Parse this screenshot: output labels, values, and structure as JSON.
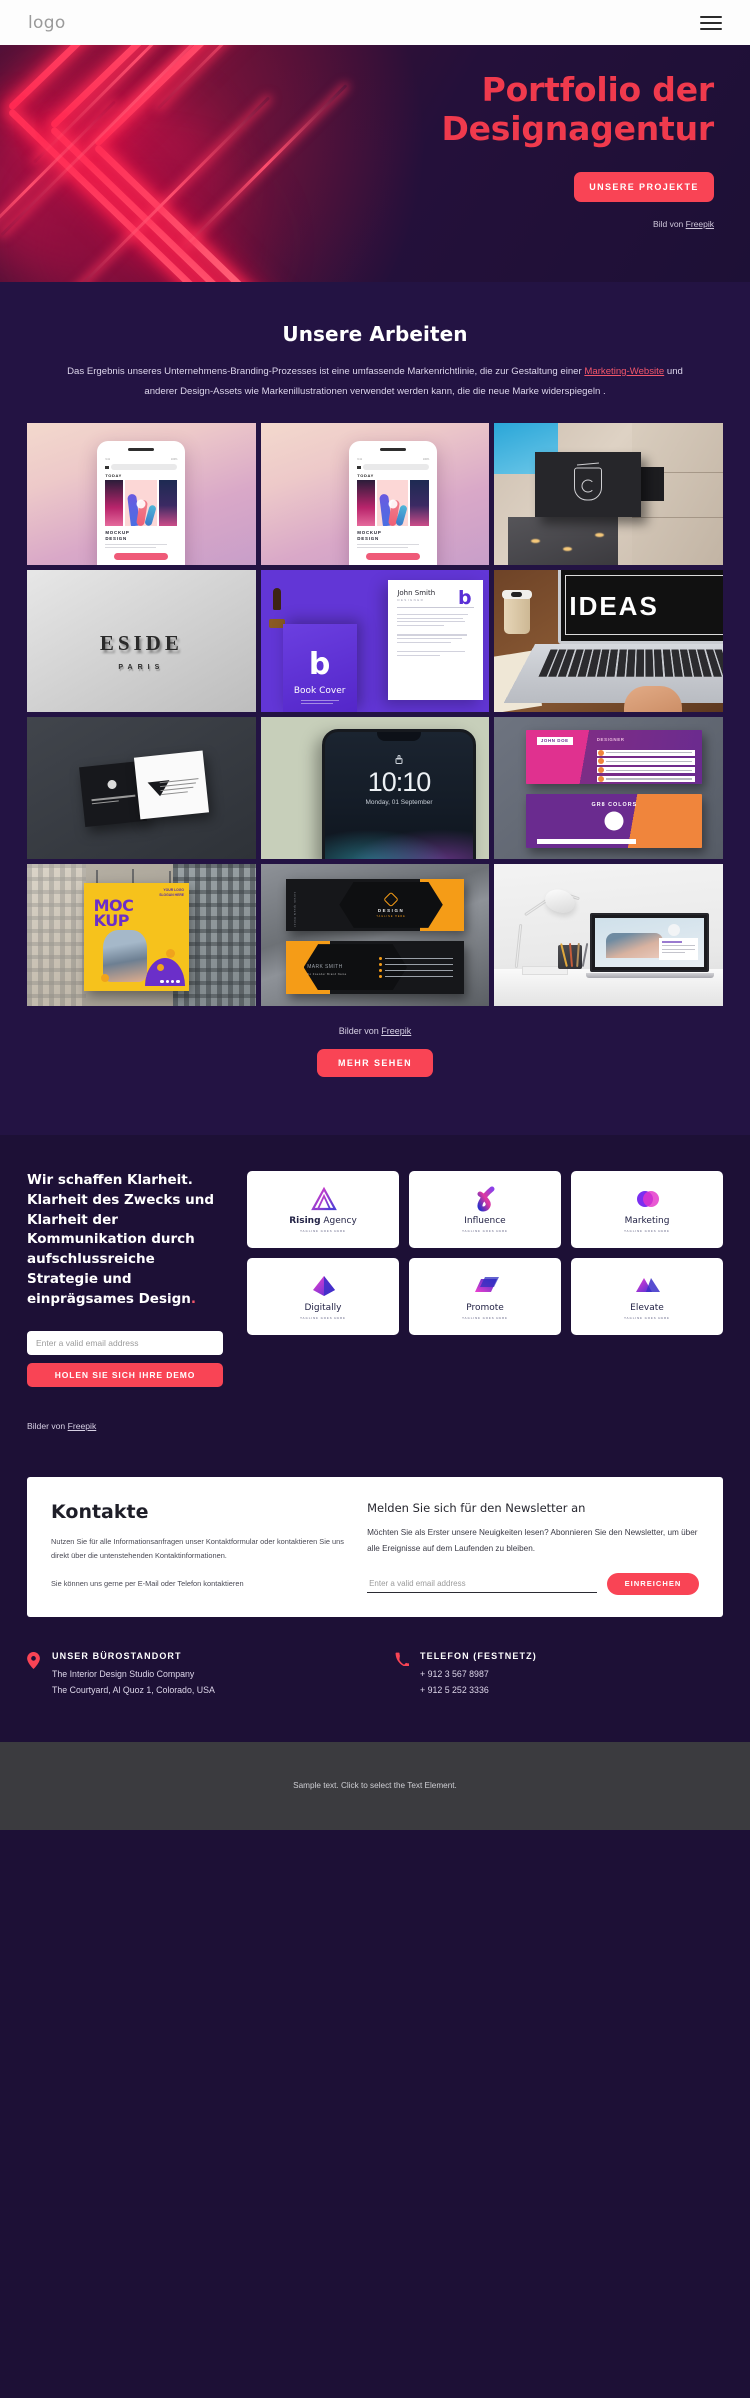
{
  "nav": {
    "logo": "logo",
    "menu_icon": "hamburger-icon"
  },
  "hero": {
    "title_line1": "Portfolio der",
    "title_line2": "Designagentur",
    "cta": "UNSERE PROJEKTE",
    "credit_prefix": "Bild von ",
    "credit_link": "Freepik"
  },
  "works": {
    "title": "Unsere Arbeiten",
    "desc_part1": "Das Ergebnis unseres Unternehmens-Branding-Prozesses ist eine umfassende Markenrichtlinie, die zur Gestaltung einer ",
    "desc_link": "Marketing-Website",
    "desc_part2": " und anderer Design-Assets wie Markenillustrationen verwendet werden kann, die die neue Marke widerspiegeln .",
    "gallery_credit_prefix": "Bilder von ",
    "gallery_credit_link": "Freepik",
    "more_button": "MEHR SEHEN",
    "tiles": [
      {
        "name": "phone-mockup-1",
        "status_left": "9:41",
        "status_right": "100%",
        "today": "TODAY",
        "caption_l1": "MOCKUP",
        "caption_l2": "DESIGN"
      },
      {
        "name": "phone-mockup-2",
        "status_left": "9:41",
        "status_right": "100%",
        "today": "TODAY",
        "caption_l1": "MOCKUP",
        "caption_l2": "DESIGN"
      },
      {
        "name": "storefront-sign-mockup"
      },
      {
        "name": "eside-paris-wall-logo",
        "word": "ESIDE",
        "sub": "PARIS"
      },
      {
        "name": "purple-branding-stationery",
        "person": "John Smith",
        "role": "DESIGNER",
        "book": "Book Cover",
        "letter": "b"
      },
      {
        "name": "laptop-ideas-desk",
        "word": "IDEAS"
      },
      {
        "name": "dark-business-cards"
      },
      {
        "name": "phone-lock-screen",
        "time": "10:10",
        "date": "Monday, 01 September"
      },
      {
        "name": "pink-purple-business-cards",
        "front_name": "JOHN DOE",
        "front_role": "DESIGNER",
        "back_title": "GR8 COLORS"
      },
      {
        "name": "billboard-mockup",
        "word_l1": "MOC",
        "word_l2": "KUP",
        "logo_l1": "YOUR LOGO",
        "logo_l2": "SLOGAN HERE"
      },
      {
        "name": "orange-black-business-cards",
        "brand": "DESIGN",
        "brand_sub": "TAGLINE HERE",
        "person_bold": "MARK ",
        "person_light": "SMITH",
        "person_role": "Co Founder Brand Name",
        "side_text": "Lorem Ipsum Dolor"
      },
      {
        "name": "desk-lamp-laptop-workspace"
      }
    ]
  },
  "clarity": {
    "heading": "Wir schaffen Klarheit. Klarheit des Zwecks und Klarheit der Kommunikation durch aufschlussreiche Strategie und einprägsames Design",
    "heading_dot": ".",
    "email_placeholder": "Enter a valid email address",
    "demo_button": "HOLEN SIE SICH IHRE DEMO",
    "credit_prefix": "Bilder von ",
    "credit_link": "Freepik",
    "logo_cards": [
      {
        "name": "Rising Agency",
        "bold": "Rising",
        "light": " Agency",
        "tagline": "TAGLINE GOES HERE",
        "mark": "triangle-outline-mark"
      },
      {
        "name": "Influence",
        "bold": "",
        "light": "Influence",
        "tagline": "TAGLINE GOES HERE",
        "mark": "brush-stroke-mark"
      },
      {
        "name": "Marketing",
        "bold": "",
        "light": "Marketing",
        "tagline": "TAGLINE GOES HERE",
        "mark": "overlapping-circles-mark"
      },
      {
        "name": "Digitally",
        "bold": "",
        "light": "Digitally",
        "tagline": "TAGLINE GOES HERE",
        "mark": "arrow-up-mark"
      },
      {
        "name": "Promote",
        "bold": "",
        "light": "Promote",
        "tagline": "TAGLINE GOES HERE",
        "mark": "parallelogram-mark"
      },
      {
        "name": "Elevate",
        "bold": "",
        "light": "Elevate",
        "tagline": "TAGLINE GOES HERE",
        "mark": "double-chevron-mark"
      }
    ]
  },
  "contact": {
    "title": "Kontakte",
    "p1": "Nutzen Sie für alle Informationsanfragen unser Kontaktformular oder kontaktieren Sie uns direkt über die untenstehenden Kontaktinformationen.",
    "p2": "Sie können uns gerne per E-Mail oder Telefon kontaktieren",
    "newsletter_title": "Melden Sie sich für den Newsletter an",
    "newsletter_p": "Möchten Sie als Erster unsere Neuigkeiten lesen? Abonnieren Sie den Newsletter, um über alle Ereignisse auf dem Laufenden zu bleiben.",
    "newsletter_placeholder": "Enter a valid email address",
    "newsletter_button": "EINREICHEN"
  },
  "footer_contact": {
    "office": {
      "icon": "location-pin-icon",
      "title": "UNSER BÜROSTANDORT",
      "line1": "The Interior Design Studio Company",
      "line2": "The Courtyard, Al Quoz 1, Colorado, USA"
    },
    "phone": {
      "icon": "phone-icon",
      "title": "TELEFON (FESTNETZ)",
      "line1": "+ 912 3 567 8987",
      "line2": "+ 912 5 252 3336"
    }
  },
  "footer": {
    "text": "Sample text. Click to select the Text Element."
  },
  "colors": {
    "accent_red": "#f94455",
    "hero_title": "#f03a4d",
    "bg_dark": "#1d1036",
    "bg_works": "#231343",
    "footer_bg": "#3b3b3f"
  }
}
